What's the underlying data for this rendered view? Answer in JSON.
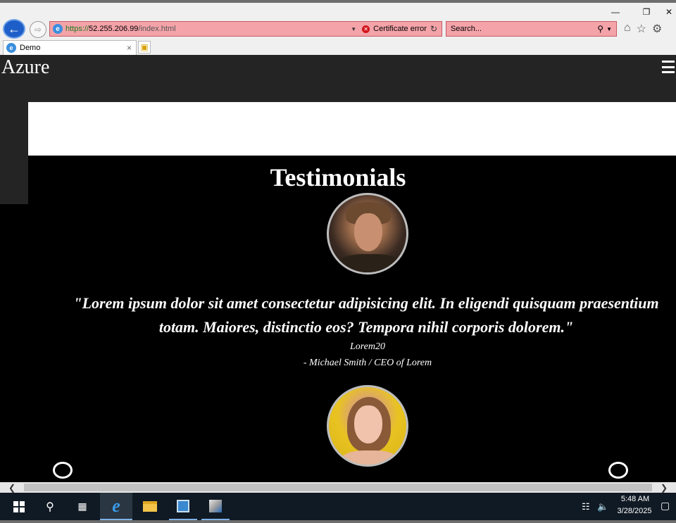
{
  "browser": {
    "url_prefix": "https://",
    "url_host": "52.255.206.99",
    "url_path": "/index.html",
    "certificate_error": "Certificate error",
    "search_placeholder": "Search...",
    "tab_title": "Demo"
  },
  "site": {
    "brand": "Azure",
    "section_title": "Testimonials",
    "testimonial": {
      "quote": "\"Lorem ipsum dolor sit amet consectetur adipisicing elit. In eligendi quisquam praesentium totam. Maiores, distinctio eos? Tempora nihil corporis dolorem.\"",
      "tag": "Lorem20",
      "author": "- Michael Smith / CEO of Lorem"
    }
  },
  "taskbar": {
    "time": "5:48 AM",
    "date": "3/28/2025"
  },
  "colors": {
    "header_bg": "#242424",
    "page_bg": "#000000",
    "address_error_bg": "#f4a3a9",
    "taskbar_bg": "#101a24"
  },
  "icons": {
    "back": "arrow-left",
    "forward": "arrow-right",
    "home": "home",
    "favorites": "star",
    "settings": "gear",
    "menu": "hamburger"
  }
}
